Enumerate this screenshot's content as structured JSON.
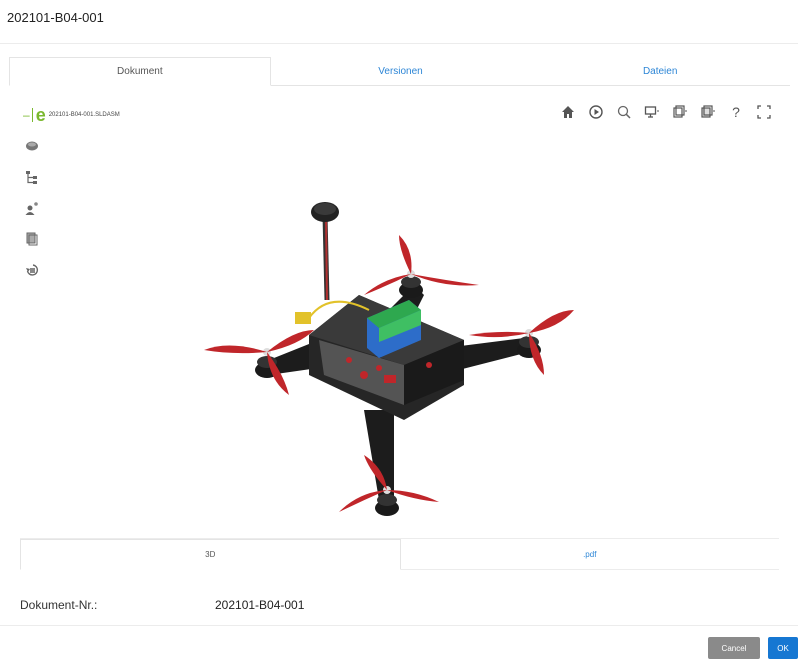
{
  "dialog": {
    "title": "202101-B04-001"
  },
  "top_tabs": [
    {
      "label": "Dokument",
      "active": true
    },
    {
      "label": "Versionen",
      "active": false
    },
    {
      "label": "Dateien",
      "active": false
    }
  ],
  "viewer": {
    "file_name": "202101-B04-001.SLDASM",
    "right_toolbar": [
      "home-icon",
      "play-icon",
      "zoom-icon",
      "display-icon",
      "section-icon",
      "explode-icon",
      "help-icon",
      "fullscreen-icon"
    ],
    "left_toolbar": [
      "parts-icon",
      "tree-icon",
      "users-icon",
      "layers-icon",
      "rotate-icon"
    ]
  },
  "bottom_tabs": [
    {
      "label": "3D",
      "active": true
    },
    {
      "label": ".pdf",
      "active": false
    }
  ],
  "fields": {
    "doc_nr_label": "Dokument-Nr.:",
    "doc_nr_value": "202101-B04-001"
  },
  "buttons": {
    "cancel_label": "Cancel",
    "ok_label": "OK"
  },
  "colors": {
    "accent": "#1677d2",
    "brand_green": "#7ab82e",
    "rotor_red": "#c0262a",
    "battery_green": "#2ea84f",
    "battery_blue": "#2d6dc9"
  }
}
